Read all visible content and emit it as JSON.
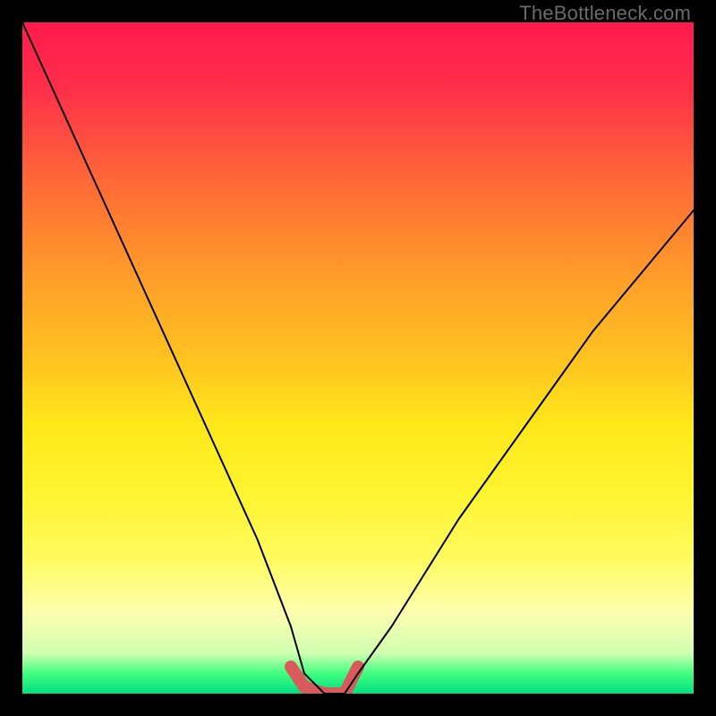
{
  "watermark": "TheBottleneck.com",
  "chart_data": {
    "type": "line",
    "title": "",
    "xlabel": "",
    "ylabel": "",
    "xlim": [
      0,
      100
    ],
    "ylim": [
      0,
      100
    ],
    "series": [
      {
        "name": "bottleneck-curve",
        "x": [
          0,
          5,
          10,
          15,
          20,
          25,
          30,
          35,
          40,
          42,
          45,
          48,
          50,
          55,
          60,
          65,
          70,
          75,
          80,
          85,
          90,
          95,
          100
        ],
        "values": [
          100,
          89,
          78,
          67,
          56,
          45,
          34,
          23,
          10,
          3,
          0,
          0,
          3,
          10,
          18,
          26,
          33,
          40,
          47,
          54,
          60,
          66,
          72
        ]
      },
      {
        "name": "highlight-strip",
        "x": [
          40,
          42,
          45,
          48,
          50
        ],
        "values": [
          4,
          1,
          0,
          0,
          4
        ]
      }
    ],
    "annotations": []
  },
  "style": {
    "curve_color": "#000000",
    "highlight_color": "#d85a5a",
    "highlight_width": 14,
    "curve_width": 2
  }
}
